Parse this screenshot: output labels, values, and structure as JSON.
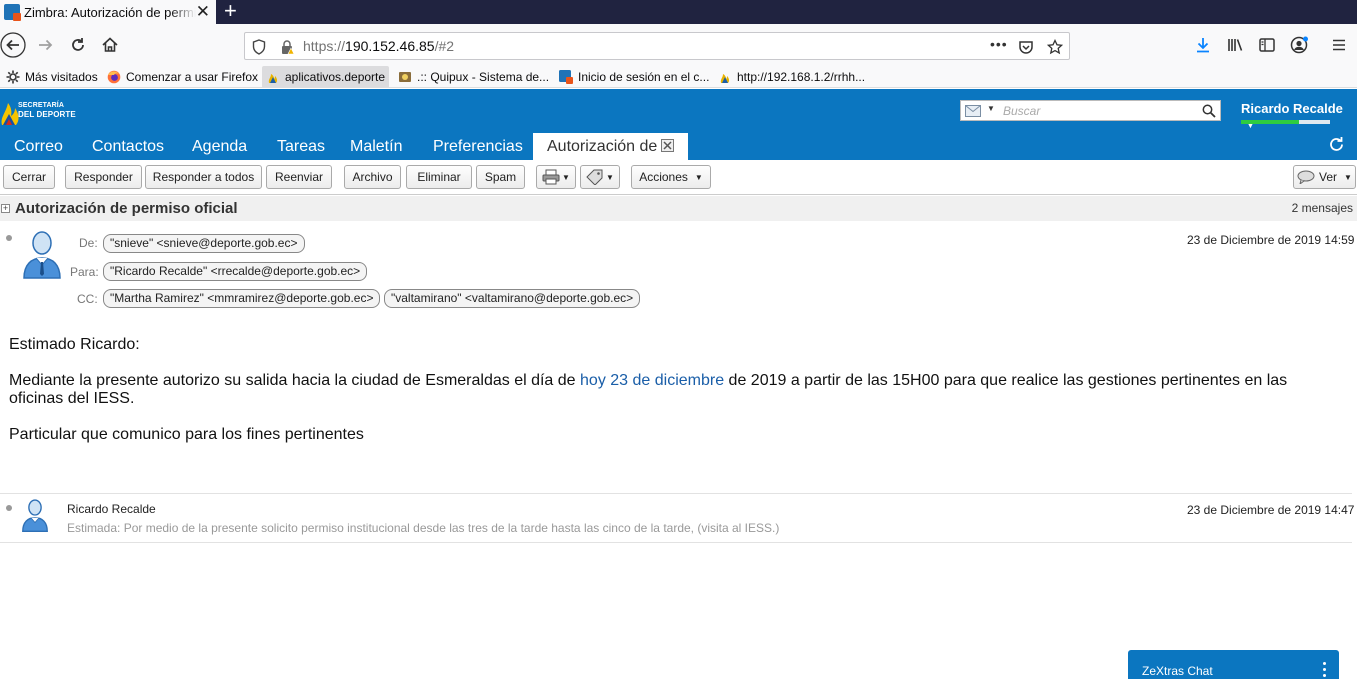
{
  "browser": {
    "tab_title": "Zimbra: Autorización de permiso oficial",
    "url_scheme": "https://",
    "url_host": "190.152.46.85",
    "url_path": "/#2",
    "url_more": "•••",
    "bookmarks": [
      {
        "label": "Más visitados"
      },
      {
        "label": "Comenzar a usar Firefox"
      },
      {
        "label": "aplicativos.deporte"
      },
      {
        "label": ".:: Quipux - Sistema de..."
      },
      {
        "label": "Inicio de sesión en el c..."
      },
      {
        "label": "http://192.168.1.2/rrhh..."
      }
    ]
  },
  "header": {
    "logo_line1": "SECRETARÍA",
    "logo_line2": "DEL DEPORTE",
    "search_placeholder": "Buscar",
    "user_name": "Ricardo Recalde",
    "quota_fraction": 0.65
  },
  "apptabs": [
    {
      "label": "Correo"
    },
    {
      "label": "Contactos"
    },
    {
      "label": "Agenda"
    },
    {
      "label": "Tareas"
    },
    {
      "label": "Maletín"
    },
    {
      "label": "Preferencias"
    },
    {
      "label": "Autorización de"
    }
  ],
  "toolbar": {
    "close": "Cerrar",
    "reply": "Responder",
    "reply_all": "Responder a todos",
    "forward": "Reenviar",
    "archive": "Archivo",
    "delete": "Eliminar",
    "spam": "Spam",
    "actions": "Acciones",
    "view": "Ver"
  },
  "conversation": {
    "title": "Autorización de permiso oficial",
    "count": "2 mensajes"
  },
  "message1": {
    "from_label": "De:",
    "to_label": "Para:",
    "cc_label": "CC:",
    "from": "\"snieve\" <snieve@deporte.gob.ec>",
    "to": "\"Ricardo Recalde\" <rrecalde@deporte.gob.ec>",
    "cc1": "\"Martha Ramirez\" <mmramirez@deporte.gob.ec>",
    "cc2": "\"valtamirano\" <valtamirano@deporte.gob.ec>",
    "date": "23 de Diciembre de 2019 14:59",
    "greeting": "Estimado Ricardo:",
    "para1_a": "Mediante la presente autorizo su salida hacia la ciudad de Esmeraldas el día de ",
    "para1_link": "hoy 23 de diciembre",
    "para1_b": " de 2019 a partir de las 15H00 para que realice las gestiones pertinentes en las",
    "para1_c": "oficinas del IESS.",
    "para2": "Particular que comunico para los fines pertinentes"
  },
  "message2": {
    "from": "Ricardo Recalde",
    "snippet": "Estimada: Por medio de la presente solicito permiso institucional desde las tres de la tarde hasta las cinco de la tarde, (visita al IESS.)",
    "date": "23 de Diciembre de 2019 14:47"
  },
  "chat": {
    "title": "ZeXtras Chat"
  }
}
